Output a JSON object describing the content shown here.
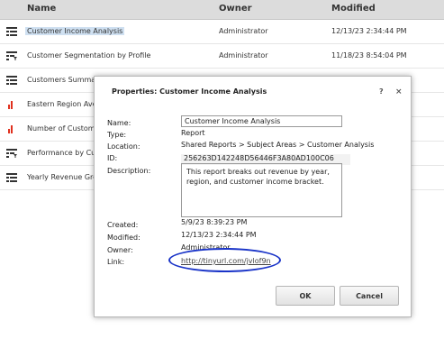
{
  "list": {
    "columns": {
      "name": "Name",
      "owner": "Owner",
      "modified": "Modified"
    },
    "rows": [
      {
        "name": "Customer Income Analysis",
        "owner": "Administrator",
        "modified": "12/13/23 2:34:44 PM",
        "icon": "table-report-icon",
        "selected": true
      },
      {
        "name": "Customer Segmentation by Profile",
        "owner": "Administrator",
        "modified": "11/18/23 8:54:04 PM",
        "icon": "table-filter-report-icon"
      },
      {
        "name": "Customers Summary",
        "owner": "",
        "modified": "",
        "icon": "table-report-icon"
      },
      {
        "name": "Eastern Region Aver",
        "owner": "",
        "modified": "",
        "icon": "bar-chart-icon"
      },
      {
        "name": "Number of Custome",
        "owner": "",
        "modified": "",
        "icon": "bar-chart-icon"
      },
      {
        "name": "Performance by Cus",
        "owner": "",
        "modified": "",
        "icon": "table-filter-report-icon"
      },
      {
        "name": "Yearly Revenue Gro",
        "owner": "",
        "modified": "",
        "icon": "table-report-icon"
      }
    ]
  },
  "dialog": {
    "title": "Properties: Customer Income Analysis",
    "help": "?",
    "close": "×",
    "labels": {
      "name": "Name:",
      "type": "Type:",
      "location": "Location:",
      "id": "ID:",
      "description": "Description:",
      "created": "Created:",
      "modified": "Modified:",
      "owner": "Owner:",
      "link": "Link:"
    },
    "values": {
      "name": "Customer Income Analysis",
      "type": "Report",
      "location": "Shared Reports > Subject Areas > Customer Analysis",
      "id": "256263D142248D56446F3A80AD100C06",
      "description": "This report breaks out revenue by year, region, and customer income bracket.",
      "created": "5/9/23 8:39:23 PM",
      "modified": "12/13/23 2:34:44 PM",
      "owner": "Administrator",
      "link": "http://tinyurl.com/jvlof9n"
    },
    "ok": "OK",
    "cancel": "Cancel"
  },
  "colors": {
    "highlight": "#cfe0f1",
    "annotation": "#1a34c8",
    "report_icon": "#333333",
    "chart_icon": "#e0301e"
  }
}
